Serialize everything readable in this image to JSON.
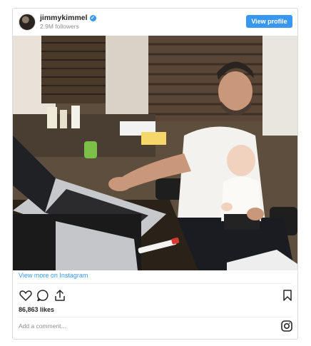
{
  "header": {
    "username": "jimmykimmel",
    "verified_mark": "✓",
    "followers": "2.9M followers",
    "view_profile_label": "View profile"
  },
  "post": {
    "view_more_label": "View more on Instagram",
    "likes": "86,863 likes",
    "comment_placeholder": "Add a comment..."
  },
  "icons": [
    "heart-icon",
    "comment-icon",
    "share-icon",
    "bookmark-icon",
    "instagram-icon"
  ],
  "colors": {
    "accent": "#3897f0",
    "text": "#262626",
    "muted": "#8e8e8e",
    "border": "#dbdbdb"
  }
}
